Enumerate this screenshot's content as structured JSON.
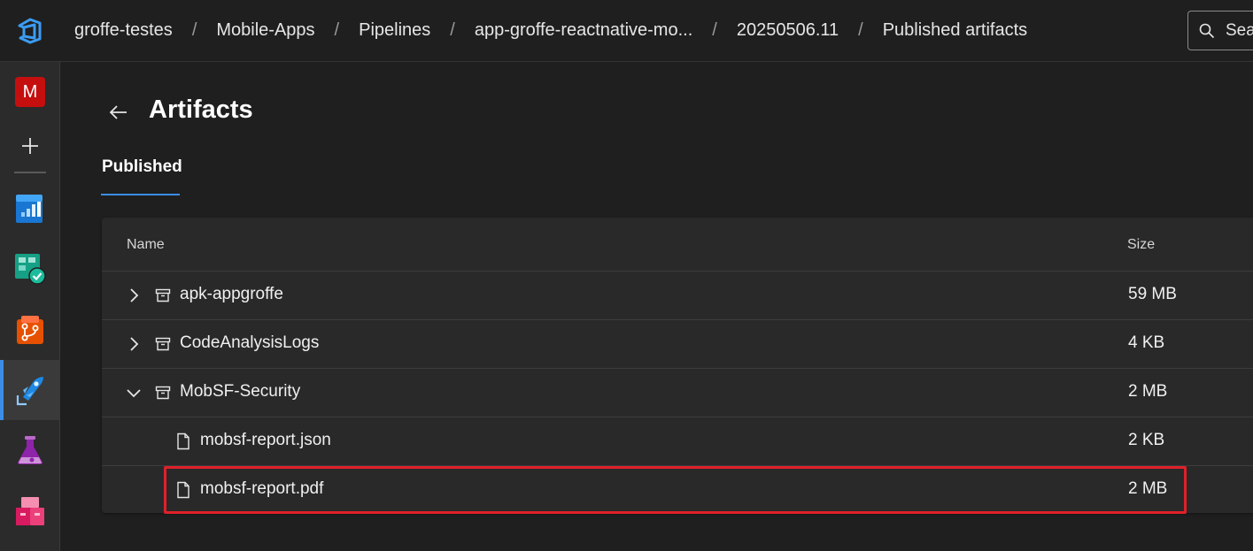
{
  "breadcrumb": {
    "items": [
      "groffe-testes",
      "Mobile-Apps",
      "Pipelines",
      "app-groffe-reactnative-mo...",
      "20250506.11",
      "Published artifacts"
    ]
  },
  "search": {
    "label": "Sea"
  },
  "rail": {
    "avatar_letter": "M",
    "items": [
      "overview-icon",
      "boards-icon",
      "repos-icon",
      "pipelines-icon",
      "test-plans-icon",
      "artifacts-icon"
    ]
  },
  "page": {
    "title": "Artifacts",
    "tab": "Published"
  },
  "table": {
    "columns": {
      "name": "Name",
      "size": "Size"
    },
    "rows": [
      {
        "name": "apk-appgroffe",
        "size": "59 MB",
        "type": "artifact",
        "expanded": false
      },
      {
        "name": "CodeAnalysisLogs",
        "size": "4 KB",
        "type": "artifact",
        "expanded": false
      },
      {
        "name": "MobSF-Security",
        "size": "2 MB",
        "type": "artifact",
        "expanded": true
      },
      {
        "name": "mobsf-report.json",
        "size": "2 KB",
        "type": "file"
      },
      {
        "name": "mobsf-report.pdf",
        "size": "2 MB",
        "type": "file"
      }
    ]
  },
  "colors": {
    "accent": "#3b8de6",
    "highlight": "#e0202a",
    "avatar": "#c50f0f"
  }
}
